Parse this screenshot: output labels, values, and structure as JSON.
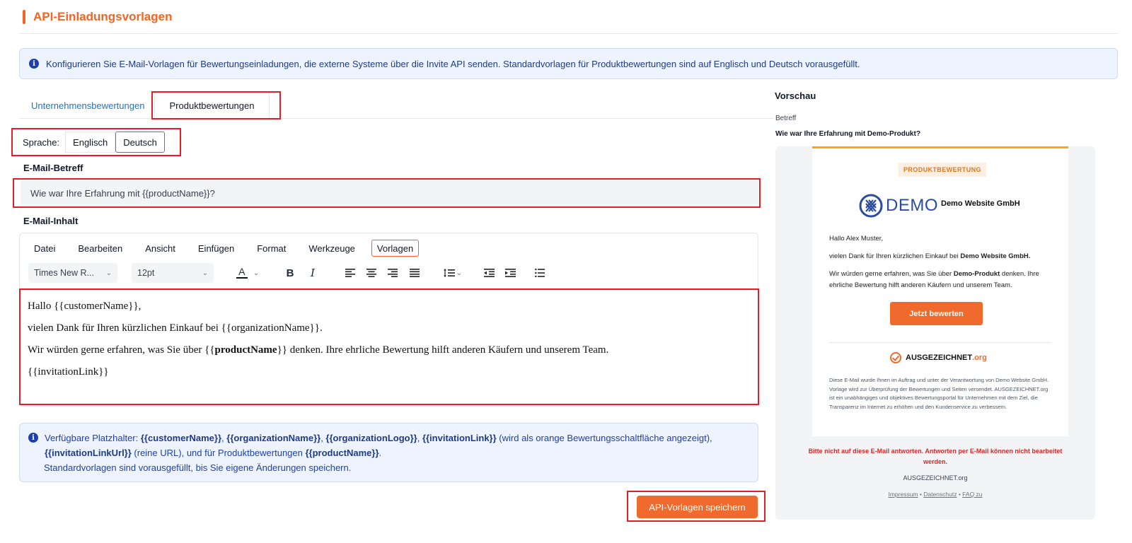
{
  "page": {
    "title": "API-Einladungsvorlagen"
  },
  "info": {
    "text": "Konfigurieren Sie E-Mail-Vorlagen für Bewertungseinladungen, die externe Systeme über die Invite API senden. Standardvorlagen für Produktbewertungen sind auf Englisch und Deutsch vorausgefüllt."
  },
  "tabs": [
    {
      "label": "Unternehmensbewertungen"
    },
    {
      "label": "Produktbewertungen",
      "selected": true
    }
  ],
  "language": {
    "label": "Sprache:",
    "options": [
      {
        "label": "Englisch"
      },
      {
        "label": "Deutsch",
        "selected": true
      }
    ]
  },
  "subject": {
    "label": "E-Mail-Betreff",
    "value": "Wie war Ihre Erfahrung mit {{productName}}?"
  },
  "content": {
    "label": "E-Mail-Inhalt"
  },
  "editor": {
    "menu": [
      "Datei",
      "Bearbeiten",
      "Ansicht",
      "Einfügen",
      "Format",
      "Werkzeuge",
      "Vorlagen"
    ],
    "font_family": "Times New R...",
    "font_size": "12pt",
    "body": {
      "greeting": "Hallo {{customerName}},",
      "thanks": "vielen Dank für Ihren kürzlichen Einkauf bei {{organizationName}}.",
      "ask_pre": "Wir würden gerne erfahren, was Sie über {{",
      "ask_bold": "productName",
      "ask_post": "}} denken. Ihre ehrliche Bewertung hilft anderen Käufern und unserem Team.",
      "link": "{{invitationLink}}"
    }
  },
  "placeholders": {
    "intro": "Verfügbare Platzhalter: ",
    "p1": "{{customerName}}",
    "p2": "{{organizationName}}",
    "p3": "{{organizationLogo}}",
    "p4": "{{invitationLink}}",
    "p4_note": " (wird als orange Bewertungsschaltfläche angezeigt),",
    "p5": "{{invitationLinkUrl}}",
    "p5_note": " (reine URL), und für Produktbewertungen ",
    "p6": "{{productName}}",
    "end": ".",
    "note": "Standardvorlagen sind vorausgefüllt, bis Sie eigene Änderungen speichern."
  },
  "save_button": "API-Vorlagen speichern",
  "preview": {
    "title": "Vorschau",
    "subject_label": "Betreff",
    "subject": "Wie war Ihre Erfahrung mit Demo-Produkt?",
    "badge": "PRODUKTBEWERTUNG",
    "logo_text": "DEMO",
    "company": "Demo Website GmbH",
    "greeting": "Hallo Alex Muster,",
    "thanks_pre": "vielen Dank für Ihren kürzlichen Einkauf bei ",
    "thanks_bold": "Demo Website GmbH.",
    "ask_pre": "Wir würden gerne erfahren, was Sie über ",
    "ask_bold": "Demo-Produkt",
    "ask_post": " denken. Ihre ehrliche Bewertung hilft anderen Käufern und unserem Team.",
    "cta": "Jetzt bewerten",
    "brand_main": "AUSGEZEICHNET",
    "brand_suffix": ".org",
    "disclaimer": "Diese E-Mail wurde Ihnen im Auftrag und unter der Verantwortung von Demo Website GmbH. Vorlage wird zur Überprüfung der Bewertungen und Seiten versendet. AUSGEZEICHNET.org ist ein unabhängiges und objektives Bewertungsportal für Unternehmen mit dem Ziel, die Transparenz im Internet zu erhöhen und den Kundenservice zu verbessern.",
    "warning": "Bitte nicht auf diese E-Mail antworten. Antworten per E-Mail können nicht bearbeitet werden.",
    "footer_brand": "AUSGEZEICHNET.org",
    "footer_links": [
      "Impressum",
      "Datenschutz",
      "FAQ zu"
    ],
    "footer_sep": " • "
  },
  "colors": {
    "accent": "#f26522",
    "link": "#1d72c8",
    "info_bg": "#eef4ff",
    "highlight": "#e21f26",
    "warning": "#dc2626"
  }
}
